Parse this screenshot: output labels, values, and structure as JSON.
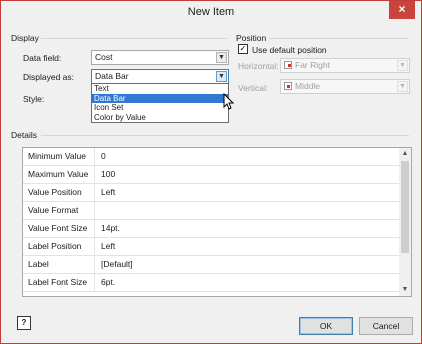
{
  "window": {
    "title": "New Item",
    "close_label": "×"
  },
  "display": {
    "section_label": "Display",
    "data_field_label": "Data field:",
    "data_field_value": "Cost",
    "displayed_as_label": "Displayed as:",
    "displayed_as_value": "Data Bar",
    "style_label": "Style:",
    "options": [
      "Text",
      "Data Bar",
      "Icon Set",
      "Color by Value"
    ],
    "selected_option": "Data Bar"
  },
  "position": {
    "section_label": "Position",
    "use_default_label": "Use default position",
    "use_default_checked": true,
    "horizontal_label": "Horizontal:",
    "horizontal_value": "Far Right",
    "vertical_label": "Vertical:",
    "vertical_value": "Middle"
  },
  "details": {
    "section_label": "Details",
    "rows": [
      {
        "key": "Minimum Value",
        "value": "0"
      },
      {
        "key": "Maximum Value",
        "value": "100"
      },
      {
        "key": "Value Position",
        "value": "Left"
      },
      {
        "key": "Value Format",
        "value": ""
      },
      {
        "key": "Value Font Size",
        "value": "14pt."
      },
      {
        "key": "Label Position",
        "value": "Left"
      },
      {
        "key": "Label",
        "value": "[Default]"
      },
      {
        "key": "Label Font Size",
        "value": "6pt."
      }
    ]
  },
  "buttons": {
    "help_label": "?",
    "ok_label": "OK",
    "cancel_label": "Cancel"
  },
  "colors": {
    "accent": "#3078d2",
    "close": "#c7453a",
    "window_border": "#c23c3c"
  }
}
